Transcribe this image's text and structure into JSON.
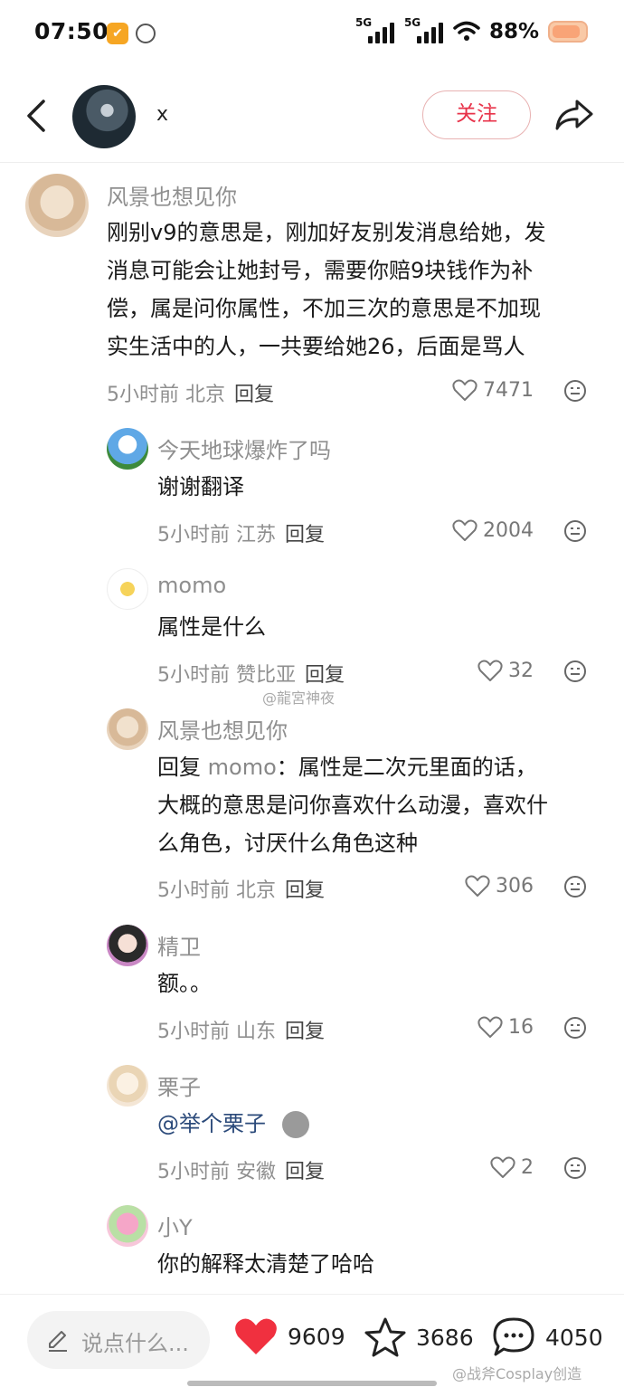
{
  "status_bar": {
    "time": "07:50",
    "signal1_label": "5G",
    "signal2_label": "5G",
    "battery": "88%"
  },
  "header": {
    "username": "x",
    "follow_label": "关注"
  },
  "comments": [
    {
      "user": "风景也想见你",
      "lines": [
        "刚别v9的意思是，刚加好友别发消息给她，发",
        "消息可能会让她封号，需要你赔9块钱作为补",
        "偿，属是问你属性，不加三次的意思是不加现",
        "实生活中的人，一共要给她26，后面是骂人"
      ],
      "time": "5小时前",
      "location": "北京",
      "reply_label": "回复",
      "likes": "7471"
    },
    {
      "user": "今天地球爆炸了吗",
      "lines": [
        "谢谢翻译"
      ],
      "time": "5小时前",
      "location": "江苏",
      "reply_label": "回复",
      "likes": "2004"
    },
    {
      "user": "momo",
      "lines": [
        "属性是什么"
      ],
      "time": "5小时前",
      "location": "赞比亚",
      "reply_label": "回复",
      "likes": "32"
    },
    {
      "user": "风景也想见你",
      "reply_prefix": "回复",
      "reply_to": "momo",
      "lines": [
        "：属性是二次元里面的话，",
        "大概的意思是问你喜欢什么动漫，喜欢什",
        "么角色，讨厌什么角色这种"
      ],
      "time": "5小时前",
      "location": "北京",
      "reply_label": "回复",
      "likes": "306"
    },
    {
      "user": "精卫",
      "lines": [
        "额。。"
      ],
      "time": "5小时前",
      "location": "山东",
      "reply_label": "回复",
      "likes": "16"
    },
    {
      "user": "栗子",
      "lines": [
        "@举个栗子"
      ],
      "time": "5小时前",
      "location": "安徽",
      "reply_label": "回复",
      "likes": "2"
    },
    {
      "user": "小Y",
      "lines": [
        "你的解释太清楚了哈哈"
      ]
    }
  ],
  "watermark_mid": "@龍宮神夜",
  "watermark_bottom": "@战斧Cosplay创造",
  "bottom_bar": {
    "input_placeholder": "说点什么...",
    "likes": "9609",
    "favorites": "3686",
    "comments": "4050"
  },
  "colors": {
    "follow_red": "#e8334a",
    "heart_red": "#f0303f",
    "meta_gray": "#8f8f8f"
  }
}
